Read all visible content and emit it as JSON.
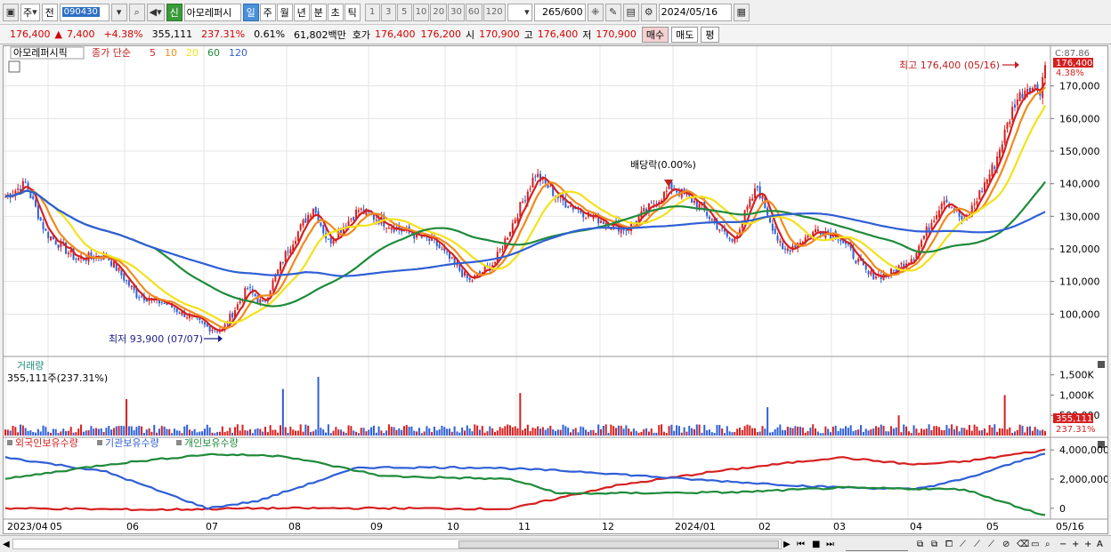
{
  "toolbar": {
    "period_jo": "주",
    "prev_label": "전",
    "stock_code": "090430",
    "badge_new": "신",
    "stock_name": "아모레퍼시",
    "periods": [
      "일",
      "주",
      "월",
      "년",
      "분",
      "초",
      "틱"
    ],
    "active_period": "일",
    "intervals": [
      "1",
      "3",
      "5",
      "10",
      "20",
      "30",
      "60",
      "120"
    ],
    "count": "265",
    "count_total": "/600",
    "date": "2024/05/16"
  },
  "quote": {
    "price": "176,400",
    "change_arrow": "▲",
    "change": "7,400",
    "change_pct": "+4.38%",
    "volume": "355,111",
    "volume_ratio": "237.31%",
    "turnover": "0.61%",
    "amount": "61,802백만",
    "hoga_label": "호가",
    "ask": "176,400",
    "bid": "176,200",
    "open_label": "시",
    "open": "170,900",
    "high_label": "고",
    "high": "176,400",
    "low_label": "저",
    "low": "170,900",
    "buy_label": "매수",
    "sell_label": "매도",
    "avg_label": "평"
  },
  "price_panel": {
    "stock_tag": "아모레퍼시픽",
    "ma_legend": "종가 단순",
    "ma_periods": [
      {
        "p": "5",
        "color": "#d62020"
      },
      {
        "p": "10",
        "color": "#f08a1c"
      },
      {
        "p": "20",
        "color": "#f3e21a"
      },
      {
        "p": "60",
        "color": "#1f8a3a"
      },
      {
        "p": "120",
        "color": "#2f5fd6"
      }
    ],
    "high_annotation": "최고 176,400 (05/16)",
    "low_annotation": "최저 93,900 (07/07)",
    "dividend_annotation": "배당락(0.00%)",
    "prev_close_tag": "C:87.86",
    "last_tag": "176,400",
    "change_tag": "4.38%",
    "y_ticks": [
      "170,000",
      "160,000",
      "150,000",
      "140,000",
      "130,000",
      "120,000",
      "110,000",
      "100,000"
    ]
  },
  "volume_panel": {
    "title": "거래량",
    "value_text": "355,111주(237.31%)",
    "y_ticks": [
      "1,500K",
      "1,000K",
      "500,000"
    ],
    "last_tag": "355,111",
    "ratio_tag": "237.31%"
  },
  "holdings_panel": {
    "series": [
      {
        "name": "외국인보유수량",
        "color": "#d62020"
      },
      {
        "name": "기관보유수량",
        "color": "#2f5fd6"
      },
      {
        "name": "개인보유수량",
        "color": "#1f8a3a"
      }
    ],
    "y_ticks": [
      "4,000,000",
      "2,000,000",
      "0"
    ]
  },
  "x_axis": {
    "labels": [
      "2023/04",
      "05",
      "06",
      "07",
      "08",
      "09",
      "10",
      "11",
      "12",
      "2024/01",
      "02",
      "03",
      "04",
      "05"
    ],
    "right_label": "05/16"
  },
  "colors": {
    "up": "#d62020",
    "down": "#2f5fd6",
    "grid": "#e4e4e4"
  },
  "chart_data": {
    "type": "line",
    "title": "",
    "price_ylim": [
      90000,
      180000
    ],
    "volume_ylim": [
      0,
      1800000
    ],
    "holdings_ylim": [
      -500000,
      4500000
    ],
    "price_key_points": [
      {
        "t": 0,
        "v": 136000
      },
      {
        "t": 8,
        "v": 140000
      },
      {
        "t": 16,
        "v": 125000
      },
      {
        "t": 28,
        "v": 117000
      },
      {
        "t": 40,
        "v": 118000
      },
      {
        "t": 52,
        "v": 106000
      },
      {
        "t": 64,
        "v": 103000
      },
      {
        "t": 80,
        "v": 96000
      },
      {
        "t": 86,
        "v": 95000
      },
      {
        "t": 96,
        "v": 108000
      },
      {
        "t": 102,
        "v": 103000
      },
      {
        "t": 112,
        "v": 120000
      },
      {
        "t": 122,
        "v": 133000
      },
      {
        "t": 128,
        "v": 122000
      },
      {
        "t": 140,
        "v": 132000
      },
      {
        "t": 156,
        "v": 126000
      },
      {
        "t": 170,
        "v": 122000
      },
      {
        "t": 184,
        "v": 110000
      },
      {
        "t": 194,
        "v": 116000
      },
      {
        "t": 210,
        "v": 143000
      },
      {
        "t": 220,
        "v": 135000
      },
      {
        "t": 232,
        "v": 130000
      },
      {
        "t": 246,
        "v": 126000
      },
      {
        "t": 264,
        "v": 139000
      },
      {
        "t": 274,
        "v": 134000
      },
      {
        "t": 288,
        "v": 122000
      },
      {
        "t": 298,
        "v": 139000
      },
      {
        "t": 308,
        "v": 119000
      },
      {
        "t": 322,
        "v": 126000
      },
      {
        "t": 330,
        "v": 124000
      },
      {
        "t": 342,
        "v": 112000
      },
      {
        "t": 350,
        "v": 112000
      },
      {
        "t": 360,
        "v": 118000
      },
      {
        "t": 372,
        "v": 136000
      },
      {
        "t": 380,
        "v": 128000
      },
      {
        "t": 392,
        "v": 146000
      },
      {
        "t": 400,
        "v": 165000
      },
      {
        "t": 405,
        "v": 170000
      },
      {
        "t": 410,
        "v": 169000
      },
      {
        "t": 412,
        "v": 176400
      }
    ],
    "volume_spikes": [
      {
        "t": 48,
        "v": 900000
      },
      {
        "t": 110,
        "v": 1150000
      },
      {
        "t": 124,
        "v": 1450000
      },
      {
        "t": 204,
        "v": 1050000
      },
      {
        "t": 302,
        "v": 700000
      },
      {
        "t": 354,
        "v": 500000
      },
      {
        "t": 396,
        "v": 1000000
      }
    ],
    "holdings": [
      {
        "name": "외국인보유수량",
        "points": [
          [
            0,
            0
          ],
          [
            60,
            -100000
          ],
          [
            100,
            0
          ],
          [
            160,
            0
          ],
          [
            200,
            -50000
          ],
          [
            240,
            1500000
          ],
          [
            280,
            2500000
          ],
          [
            330,
            3500000
          ],
          [
            360,
            3000000
          ],
          [
            380,
            3200000
          ],
          [
            412,
            4000000
          ]
        ]
      },
      {
        "name": "기관보유수량",
        "points": [
          [
            0,
            3500000
          ],
          [
            40,
            2500000
          ],
          [
            80,
            0
          ],
          [
            100,
            500000
          ],
          [
            140,
            2800000
          ],
          [
            190,
            2800000
          ],
          [
            230,
            2500000
          ],
          [
            270,
            2000000
          ],
          [
            320,
            1500000
          ],
          [
            360,
            1300000
          ],
          [
            380,
            2000000
          ],
          [
            412,
            3800000
          ]
        ]
      },
      {
        "name": "개인보유수량",
        "points": [
          [
            0,
            2000000
          ],
          [
            40,
            3000000
          ],
          [
            80,
            3700000
          ],
          [
            110,
            3600000
          ],
          [
            150,
            2200000
          ],
          [
            200,
            2000000
          ],
          [
            220,
            1000000
          ],
          [
            290,
            1100000
          ],
          [
            330,
            1400000
          ],
          [
            380,
            1300000
          ],
          [
            412,
            -500000
          ]
        ]
      }
    ]
  }
}
